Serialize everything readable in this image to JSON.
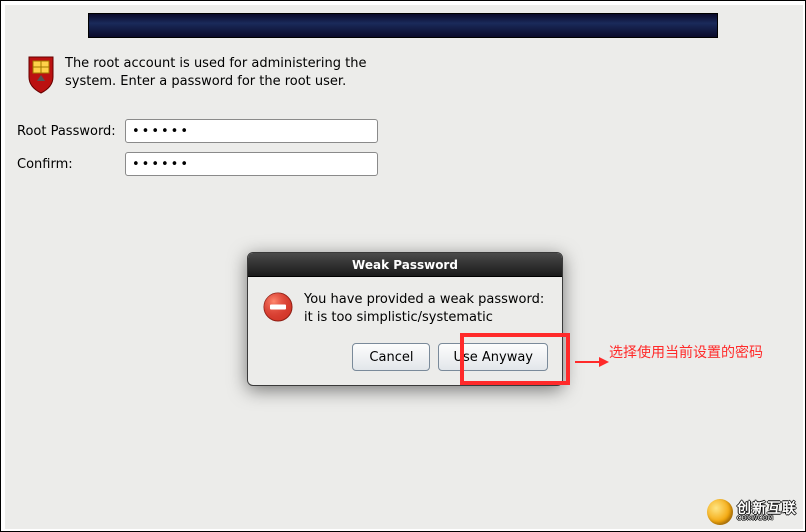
{
  "info_text": "The root account is used for administering the system.  Enter a password for the root user.",
  "root_password": {
    "label": "Root Password:",
    "value": "••••••"
  },
  "confirm": {
    "label": "Confirm:",
    "value": "••••••"
  },
  "dialog": {
    "title": "Weak Password",
    "message": "You have provided a weak password: it is too simplistic/systematic",
    "cancel_label": "Cancel",
    "use_anyway_label": "Use Anyway"
  },
  "annotation": "选择使用当前设置的密码",
  "watermark": {
    "line1": "创新互联",
    "line2": "CDXWCOM"
  }
}
